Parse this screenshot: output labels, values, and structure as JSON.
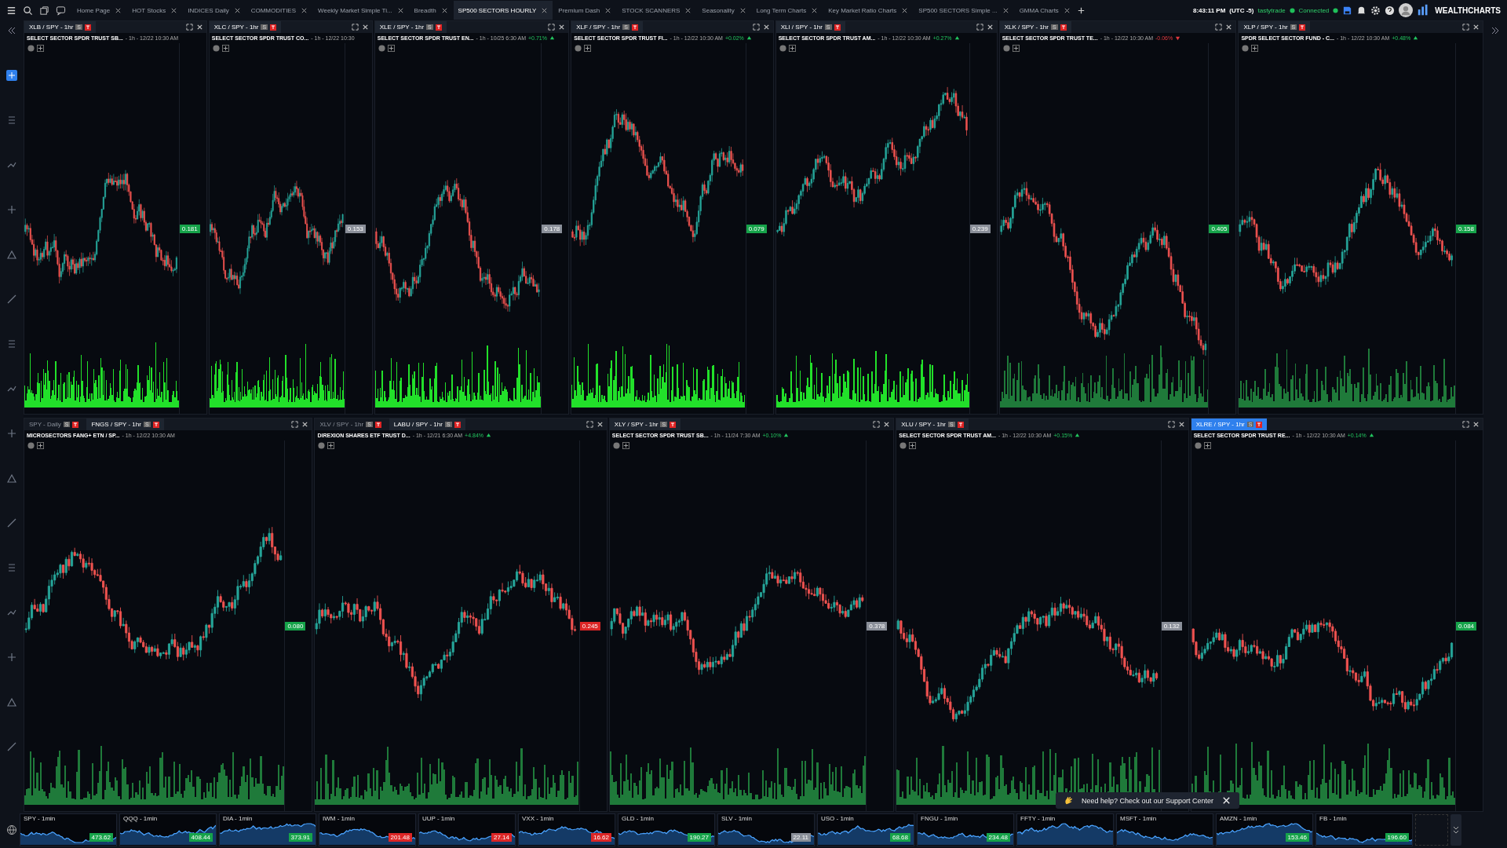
{
  "tabs": [
    {
      "label": "Home Page",
      "selected": false
    },
    {
      "label": "HOT Stocks",
      "selected": false
    },
    {
      "label": "INDICES Daily",
      "selected": false
    },
    {
      "label": "COMMODITIES",
      "selected": false
    },
    {
      "label": "Weekly Market Simple Ti...",
      "selected": false
    },
    {
      "label": "Breadth",
      "selected": false
    },
    {
      "label": "SP500 SECTORS HOURLY",
      "selected": true
    },
    {
      "label": "Premium Dash",
      "selected": false
    },
    {
      "label": "STOCK SCANNERS",
      "selected": false
    },
    {
      "label": "Seasonality",
      "selected": false
    },
    {
      "label": "Long Term Charts",
      "selected": false
    },
    {
      "label": "Key Market Ratio Charts",
      "selected": false
    },
    {
      "label": "SP500 SECTORS Simple ...",
      "selected": false
    },
    {
      "label": "GMMA Charts",
      "selected": false
    }
  ],
  "clock": "8:43:11 PM",
  "timezone": "(UTC -5)",
  "broker": "tastytrade",
  "connection": "Connected",
  "brand": "WEALTHCHARTS",
  "panel_rows": [
    [
      {
        "tabs": [
          {
            "label": "XLB / SPY - 1hr",
            "badge": "S",
            "selected": true
          }
        ],
        "title": "SELECT SECTOR SPDR TRUST SB...",
        "meta": "- 1h - 12/22 10:30 AM",
        "price_tag": {
          "text": "0.181",
          "color": "#16a34a"
        },
        "volume": {
          "color": "#22e02a"
        },
        "focused": false
      },
      {
        "tabs": [
          {
            "label": "XLC / SPY - 1hr",
            "badge": "S",
            "selected": true
          }
        ],
        "title": "SELECT SECTOR SPDR TRUST CO...",
        "meta": "- 1h - 12/22 10:30",
        "price_tag": {
          "text": "0.153",
          "color": "#8a8f99"
        },
        "volume": {
          "color": "#22e02a"
        },
        "focused": false
      },
      {
        "tabs": [
          {
            "label": "XLE / SPY - 1hr",
            "badge": "S",
            "selected": true
          }
        ],
        "title": "SELECT SECTOR SPDR TRUST EN...",
        "meta": "- 1h - 10/25 6:30 AM",
        "change": {
          "text": "+0.71%",
          "rising": true
        },
        "price_tag": {
          "text": "0.178",
          "color": "#8a8f99"
        },
        "volume": {
          "color": "#22e02a"
        },
        "focused": false
      },
      {
        "tabs": [
          {
            "label": "XLF / SPY - 1hr",
            "badge": "S",
            "selected": true
          }
        ],
        "title": "SELECT SECTOR SPDR TRUST FI...",
        "meta": "- 1h - 12/22 10:30 AM",
        "change": {
          "text": "+0.02%",
          "rising": true
        },
        "price_tag": {
          "text": "0.079",
          "color": "#16a34a"
        },
        "volume": {
          "color": "#22e02a"
        },
        "focused": false
      },
      {
        "tabs": [
          {
            "label": "XLI / SPY - 1hr",
            "badge": "S",
            "selected": true
          }
        ],
        "title": "SELECT SECTOR SPDR TRUST AM...",
        "meta": "- 1h - 12/22 10:30 AM",
        "change": {
          "text": "+0.27%",
          "rising": true
        },
        "price_tag": {
          "text": "0.239",
          "color": "#8a8f99"
        },
        "volume": {
          "color": "#22e02a"
        },
        "focused": false
      },
      {
        "tabs": [
          {
            "label": "XLK / SPY - 1hr",
            "badge": "S",
            "selected": true
          }
        ],
        "title": "SELECT SECTOR SPDR TRUST TE...",
        "meta": "- 1h - 12/22 10:30 AM",
        "change": {
          "text": "-0.06%",
          "rising": false
        },
        "price_tag": {
          "text": "0.405",
          "color": "#16a34a"
        },
        "volume": {
          "color": "#1f7a3a"
        },
        "focused": false
      },
      {
        "tabs": [
          {
            "label": "XLP / SPY - 1hr",
            "badge": "S",
            "selected": true
          }
        ],
        "title": "SPDR SELECT SECTOR FUND - C...",
        "meta": "- 1h - 12/22 10:30 AM",
        "change": {
          "text": "+0.48%",
          "rising": true
        },
        "price_tag": {
          "text": "0.158",
          "color": "#16a34a"
        },
        "volume": {
          "color": "#1f7a3a"
        },
        "focused": false
      }
    ],
    [
      {
        "tabs": [
          {
            "label": "SPY - Daily",
            "badge": "S",
            "selected": false
          },
          {
            "label": "FNGS / SPY - 1hr",
            "badge": "S",
            "selected": true
          }
        ],
        "title": "MICROSECTORS FANG+ ETN / SP...",
        "meta": "- 1h - 12/22 10:30 AM",
        "price_tag": {
          "text": "0.080",
          "color": "#16a34a"
        },
        "volume": {
          "color": "#1f7a3a"
        },
        "focused": false
      },
      {
        "tabs": [
          {
            "label": "XLV / SPY - 1hr",
            "badge": "S",
            "selected": false
          },
          {
            "label": "LABU / SPY - 1hr",
            "badge": "S",
            "selected": true
          }
        ],
        "title": "DIREXION SHARES ETF TRUST D...",
        "meta": "- 1h - 12/21 6:30 AM",
        "change": {
          "text": "+4.84%",
          "rising": true
        },
        "price_tag": {
          "text": "0.245",
          "color": "#dc2626"
        },
        "volume": {
          "color": "#1f7a3a"
        },
        "focused": false
      },
      {
        "tabs": [
          {
            "label": "XLY / SPY - 1hr",
            "badge": "S",
            "selected": true
          }
        ],
        "title": "SELECT SECTOR SPDR TRUST SB...",
        "meta": "- 1h - 11/24 7:30 AM",
        "change": {
          "text": "+0.10%",
          "rising": true
        },
        "price_tag": {
          "text": "0.378",
          "color": "#8a8f99"
        },
        "volume": {
          "color": "#1f7a3a"
        },
        "focused": false
      },
      {
        "tabs": [
          {
            "label": "XLU / SPY - 1hr",
            "badge": "S",
            "selected": true
          }
        ],
        "title": "SELECT SECTOR SPDR TRUST AM...",
        "meta": "- 1h - 12/22 10:30 AM",
        "change": {
          "text": "+0.15%",
          "rising": true
        },
        "price_tag": {
          "text": "0.132",
          "color": "#8a8f99"
        },
        "volume": {
          "color": "#1f7a3a"
        },
        "focused": false
      },
      {
        "tabs": [
          {
            "label": "XLRE / SPY - 1hr",
            "badge": "S",
            "selected": true
          }
        ],
        "title": "SELECT SECTOR SPDR TRUST RE...",
        "meta": "- 1h - 12/22 10:30 AM",
        "change": {
          "text": "+0.14%",
          "rising": true
        },
        "price_tag": {
          "text": "0.084",
          "color": "#16a34a"
        },
        "volume": {
          "color": "#1f7a3a"
        },
        "focused": true
      }
    ]
  ],
  "watchlist": [
    {
      "symbol": "SPY - 1min",
      "price": "473.62",
      "color": "#16a34a"
    },
    {
      "symbol": "QQQ - 1min",
      "price": "408.44",
      "color": "#16a34a"
    },
    {
      "symbol": "DIA - 1min",
      "price": "373.91",
      "color": "#16a34a"
    },
    {
      "symbol": "IWM - 1min",
      "price": "201.48",
      "color": "#dc2626"
    },
    {
      "symbol": "UUP - 1min",
      "price": "27.14",
      "color": "#dc2626"
    },
    {
      "symbol": "VXX - 1min",
      "price": "16.62",
      "color": "#dc2626"
    },
    {
      "symbol": "GLD - 1min",
      "price": "190.27",
      "color": "#16a34a"
    },
    {
      "symbol": "SLV - 1min",
      "price": "22.11",
      "color": "#8a8f99"
    },
    {
      "symbol": "USO - 1min",
      "price": "68.68",
      "color": "#16a34a"
    },
    {
      "symbol": "FNGU - 1min",
      "price": "234.48",
      "color": "#16a34a"
    },
    {
      "symbol": "FFTY - 1min"
    },
    {
      "symbol": "MSFT - 1min"
    },
    {
      "symbol": "AMZN - 1min",
      "price": "153.46",
      "color": "#16a34a"
    },
    {
      "symbol": "FB - 1min",
      "price": "196.60",
      "color": "#16a34a"
    }
  ],
  "toast": {
    "text": "Need help? Check out our Support Center"
  }
}
